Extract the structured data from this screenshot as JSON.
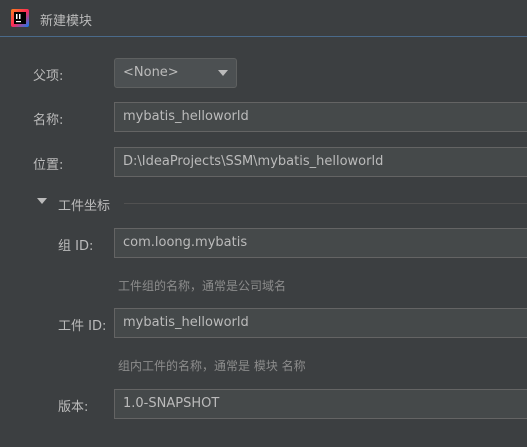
{
  "window": {
    "title": "新建模块"
  },
  "form": {
    "parent": {
      "label": "父项:",
      "value": "<None>"
    },
    "name": {
      "label": "名称:",
      "value": "mybatis_helloworld"
    },
    "location": {
      "label": "位置:",
      "value": "D:\\IdeaProjects\\SSM\\mybatis_helloworld"
    }
  },
  "artifact_section": {
    "title": "工件坐标",
    "group_id": {
      "label": "组 ID:",
      "value": "com.loong.mybatis",
      "hint": "工件组的名称，通常是公司域名"
    },
    "artifact_id": {
      "label": "工件 ID:",
      "value": "mybatis_helloworld",
      "hint": "组内工件的名称，通常是 模块 名称"
    },
    "version": {
      "label": "版本:",
      "value": "1.0-SNAPSHOT"
    }
  },
  "icons": {
    "app": "intellij-idea-icon",
    "dropdown": "chevron-down-icon",
    "section": "triangle-down-icon"
  }
}
